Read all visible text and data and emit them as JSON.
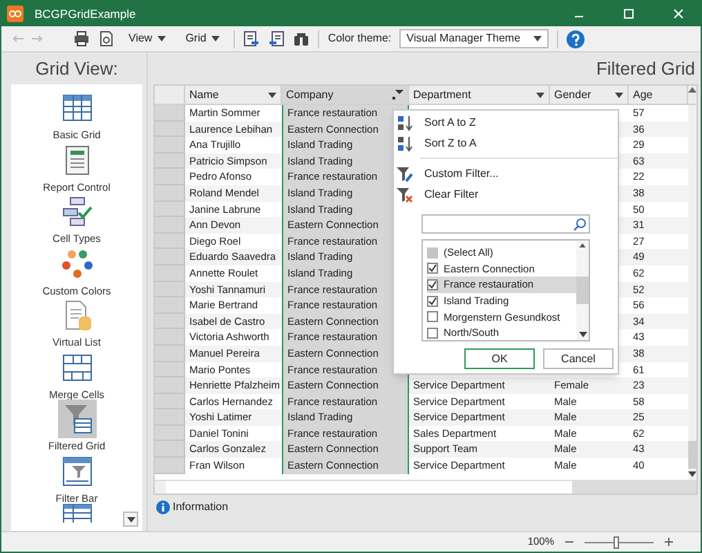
{
  "window": {
    "title": "BCGPGridExample"
  },
  "toolbar": {
    "menus": [
      {
        "label": "View"
      },
      {
        "label": "Grid"
      }
    ],
    "theme_label": "Color theme:",
    "theme_value": "Visual Manager Theme"
  },
  "sidebar": {
    "title": "Grid View:",
    "items": [
      {
        "label": "Basic Grid",
        "kind": "grid",
        "selected": false
      },
      {
        "label": "Report Control",
        "kind": "report",
        "selected": false
      },
      {
        "label": "Cell Types",
        "kind": "cells",
        "selected": false
      },
      {
        "label": "Custom Colors",
        "kind": "colors",
        "selected": false
      },
      {
        "label": "Virtual List",
        "kind": "virtual",
        "selected": false
      },
      {
        "label": "Merge Cells",
        "kind": "merge",
        "selected": false
      },
      {
        "label": "Filtered Grid",
        "kind": "filter",
        "selected": true
      },
      {
        "label": "Filter Bar",
        "kind": "filterbar",
        "selected": false
      }
    ]
  },
  "page_title": "Filtered Grid",
  "table": {
    "columns": [
      {
        "label": "Name",
        "selected": false,
        "filtered": false
      },
      {
        "label": "Company",
        "selected": true,
        "filtered": true
      },
      {
        "label": "Department",
        "selected": false,
        "filtered": false
      },
      {
        "label": "Gender",
        "selected": false,
        "filtered": false
      },
      {
        "label": "Age",
        "selected": false,
        "filtered": false
      }
    ],
    "rows": [
      {
        "name": "Martin Sommer",
        "company": "France restauration",
        "age": "57"
      },
      {
        "name": "Laurence Lebihan",
        "company": "Eastern Connection",
        "age": "36"
      },
      {
        "name": "Ana Trujillo",
        "company": "Island Trading",
        "age": "29"
      },
      {
        "name": "Patricio Simpson",
        "company": "Island Trading",
        "age": "63"
      },
      {
        "name": "Pedro Afonso",
        "company": "France restauration",
        "age": "22"
      },
      {
        "name": "Roland Mendel",
        "company": "Island Trading",
        "age": "38"
      },
      {
        "name": "Janine Labrune",
        "company": "Island Trading",
        "age": "50"
      },
      {
        "name": "Ann Devon",
        "company": "Eastern Connection",
        "age": "31"
      },
      {
        "name": "Diego Roel",
        "company": "France restauration",
        "age": "27"
      },
      {
        "name": "Eduardo Saavedra",
        "company": "Island Trading",
        "age": "49"
      },
      {
        "name": "Annette Roulet",
        "company": "Island Trading",
        "age": "62"
      },
      {
        "name": "Yoshi Tannamuri",
        "company": "France restauration",
        "age": "52"
      },
      {
        "name": "Marie Bertrand",
        "company": "France restauration",
        "age": "56"
      },
      {
        "name": "Isabel de Castro",
        "company": "Eastern Connection",
        "age": "34"
      },
      {
        "name": "Victoria Ashworth",
        "company": "France restauration",
        "age": "43"
      },
      {
        "name": "Manuel Pereira",
        "company": "Eastern Connection",
        "age": "38"
      },
      {
        "name": "Mario Pontes",
        "company": "France restauration",
        "age": "61"
      },
      {
        "name": "Henriette Pfalzheim",
        "company": "Eastern Connection",
        "department": "Service Department",
        "gender": "Female",
        "age": "23"
      },
      {
        "name": "Carlos Hernandez",
        "company": "France restauration",
        "department": "Service Department",
        "gender": "Male",
        "age": "58"
      },
      {
        "name": "Yoshi Latimer",
        "company": "Island Trading",
        "department": "Service Department",
        "gender": "Male",
        "age": "25"
      },
      {
        "name": "Daniel Tonini",
        "company": "France restauration",
        "department": "Sales Department",
        "gender": "Male",
        "age": "62"
      },
      {
        "name": "Carlos Gonzalez",
        "company": "Eastern Connection",
        "department": "Support Team",
        "gender": "Male",
        "age": "43"
      },
      {
        "name": "Fran Wilson",
        "company": "Eastern Connection",
        "department": "Service Department",
        "gender": "Male",
        "age": "40"
      }
    ]
  },
  "filter_popup": {
    "menu": [
      {
        "label": "Sort A to Z",
        "kind": "sortaz"
      },
      {
        "label": "Sort Z to A",
        "kind": "sortza"
      },
      {
        "label": "Custom Filter...",
        "kind": "custom"
      },
      {
        "label": "Clear Filter",
        "kind": "clear"
      }
    ],
    "values": [
      {
        "label": "(Select All)",
        "checked": false,
        "indeterminate": true,
        "selected": false
      },
      {
        "label": "Eastern Connection",
        "checked": true,
        "selected": false
      },
      {
        "label": "France restauration",
        "checked": true,
        "selected": true
      },
      {
        "label": "Island Trading",
        "checked": true,
        "selected": false
      },
      {
        "label": "Morgenstern Gesundkost",
        "checked": false,
        "selected": false
      },
      {
        "label": "North/South",
        "checked": false,
        "selected": false
      }
    ],
    "buttons": [
      {
        "label": "OK",
        "kind": "default"
      },
      {
        "label": "Cancel",
        "kind": "normal"
      }
    ]
  },
  "info_tab": {
    "label": "Information"
  },
  "status_bar": {
    "zoom": "100%",
    "zoom_slider": {
      "level": 0.45
    }
  }
}
